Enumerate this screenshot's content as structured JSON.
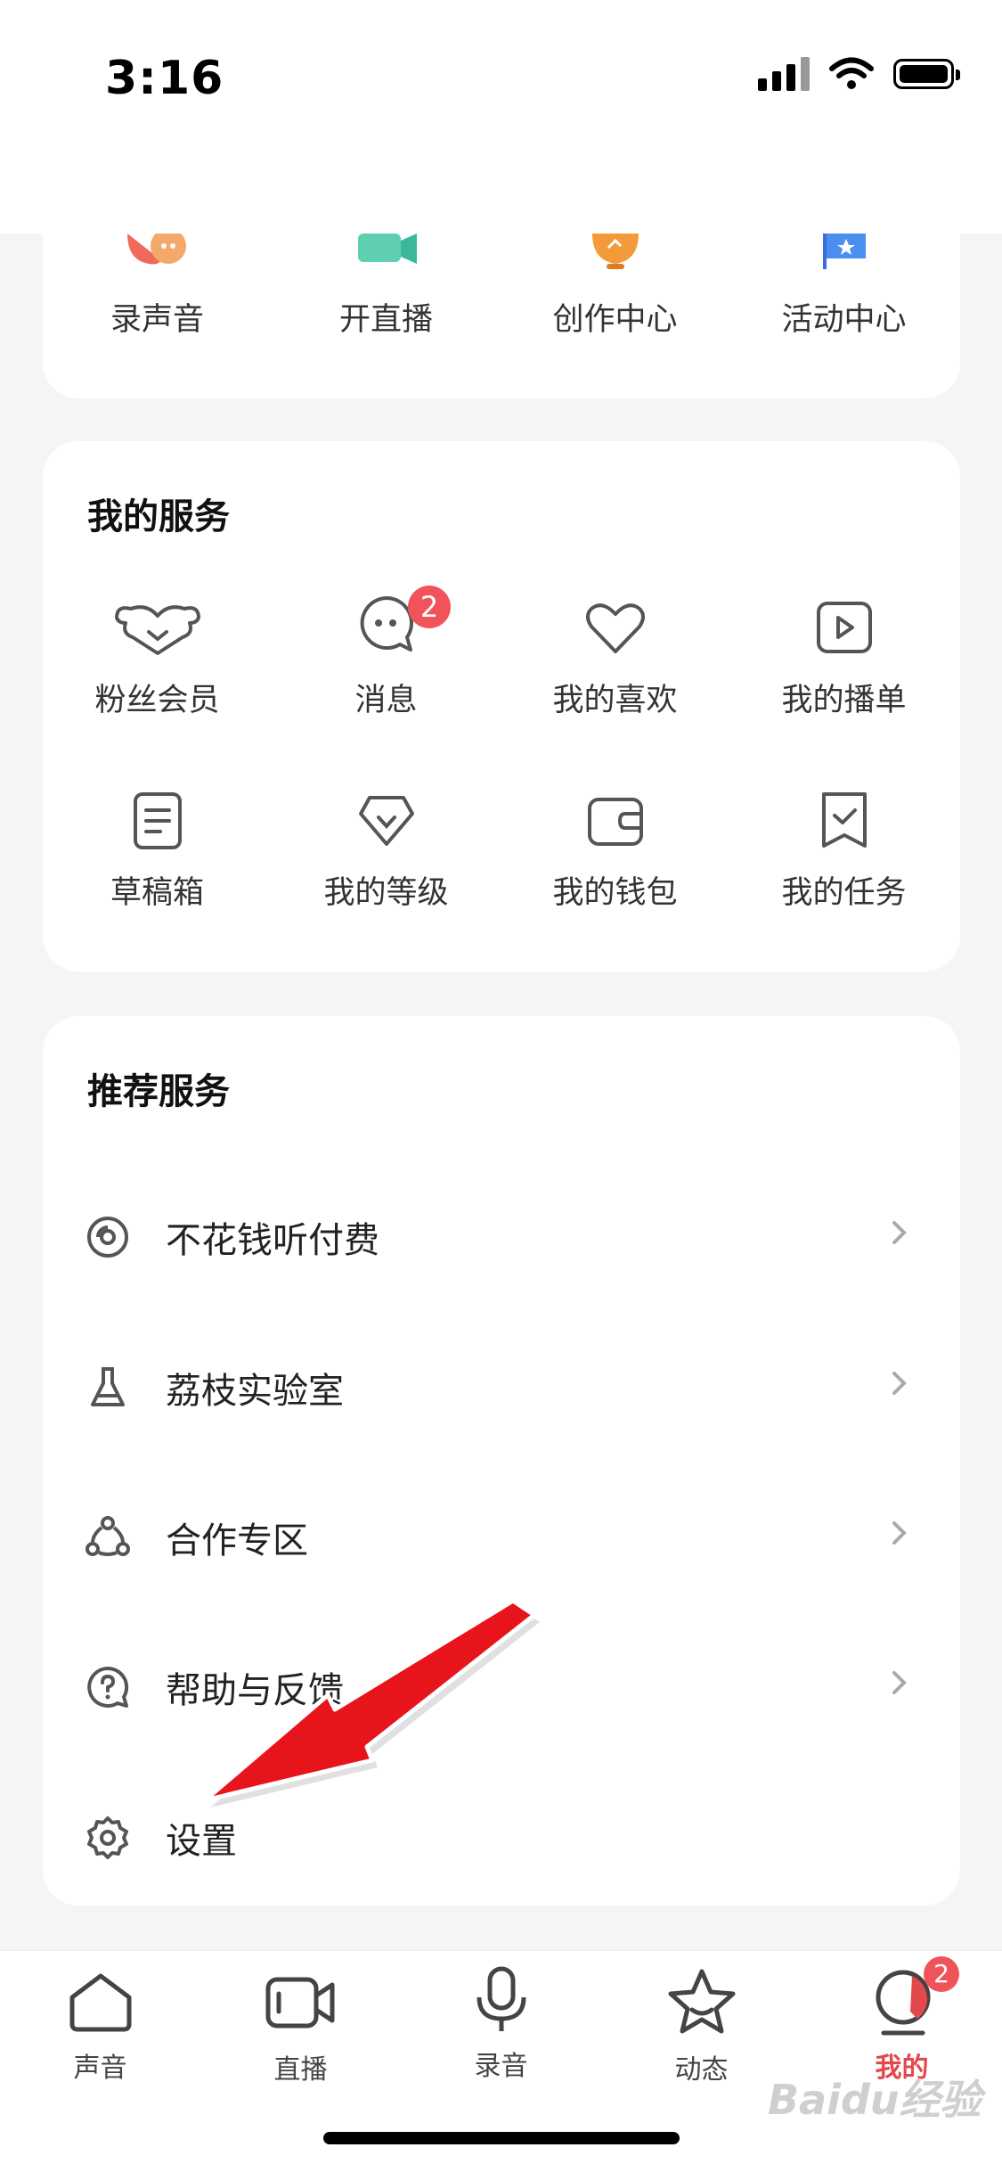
{
  "status": {
    "time": "3:16"
  },
  "quick_actions": [
    {
      "label": "录声音",
      "icon": "record-voice-icon"
    },
    {
      "label": "开直播",
      "icon": "start-live-icon"
    },
    {
      "label": "创作中心",
      "icon": "creation-center-icon"
    },
    {
      "label": "活动中心",
      "icon": "activity-center-icon"
    }
  ],
  "my_services": {
    "title": "我的服务",
    "items": [
      {
        "label": "粉丝会员",
        "icon": "fan-member-icon"
      },
      {
        "label": "消息",
        "icon": "message-icon",
        "badge": "2"
      },
      {
        "label": "我的喜欢",
        "icon": "heart-icon"
      },
      {
        "label": "我的播单",
        "icon": "playlist-icon"
      },
      {
        "label": "草稿箱",
        "icon": "draft-icon"
      },
      {
        "label": "我的等级",
        "icon": "level-diamond-icon"
      },
      {
        "label": "我的钱包",
        "icon": "wallet-icon"
      },
      {
        "label": "我的任务",
        "icon": "task-icon"
      }
    ]
  },
  "recommended": {
    "title": "推荐服务",
    "rows": [
      {
        "label": "不花钱听付费",
        "icon": "free-listen-icon"
      },
      {
        "label": "荔枝实验室",
        "icon": "flask-icon"
      },
      {
        "label": "合作专区",
        "icon": "cooperation-icon"
      },
      {
        "label": "帮助与反馈",
        "icon": "help-icon"
      },
      {
        "label": "设置",
        "icon": "gear-icon"
      }
    ]
  },
  "tabbar": {
    "tabs": [
      {
        "label": "声音"
      },
      {
        "label": "直播"
      },
      {
        "label": "录音"
      },
      {
        "label": "动态"
      },
      {
        "label": "我的",
        "badge": "2",
        "active": true
      }
    ]
  },
  "watermark": "Baidu经验",
  "colors": {
    "accent": "#e3484d",
    "badge": "#f0545a",
    "background": "#f5f5f5"
  }
}
